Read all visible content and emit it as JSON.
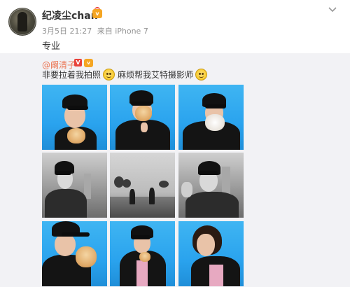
{
  "post": {
    "user_name": "纪凌尘chan",
    "meta": {
      "time": "3月5日 21:27",
      "source": "来自 iPhone 7"
    },
    "text": "专业"
  },
  "repost": {
    "author": "@阚清子",
    "text_part1": "非要拉着我拍照",
    "text_part2": "麻烦帮我艾特摄影师",
    "emoji": "smile-emoji"
  },
  "grid": {
    "photos": [
      "photo-girl-cap-cat-blue",
      "photo-girl-cap-holding-cat-blue",
      "photo-girl-cap-white-cat-blue",
      "photo-girl-cap-bw-portrait",
      "photo-bw-field-landscape",
      "photo-girl-cap-bw-gesture",
      "photo-girl-cap-cat-closeup-blue",
      "photo-girl-cap-pink-shirt-blue",
      "photo-girl-profile-blue"
    ]
  },
  "colors": {
    "link": "#eb7350",
    "meta_text": "#939393",
    "repost_bg": "#f2f2f5",
    "photo_blue": "#2aa3ee",
    "vip_badge": "#f5a623"
  },
  "icons": {
    "header_menu": "chevron-down-icon",
    "verified": "verified-v-icon",
    "vip": "vip-crown-icon"
  }
}
